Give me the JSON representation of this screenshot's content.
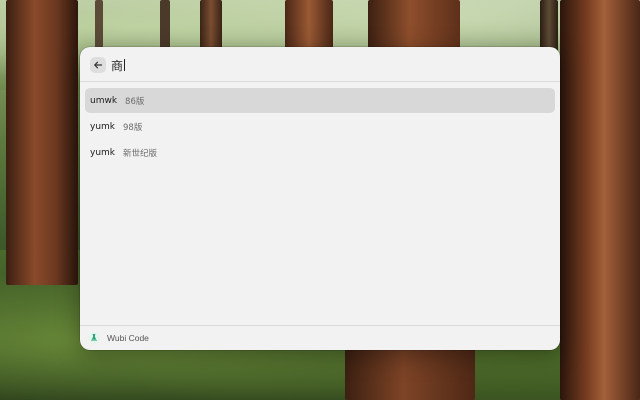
{
  "search": {
    "query": "商",
    "back_label": "Back"
  },
  "results": [
    {
      "code": "umwk",
      "version": "86版",
      "selected": true
    },
    {
      "code": "yumk",
      "version": "98版",
      "selected": false
    },
    {
      "code": "yumk",
      "version": "新世纪版",
      "selected": false
    }
  ],
  "footer": {
    "extension_name": "Wubi Code",
    "icon": "wubi-code-app-icon"
  },
  "colors": {
    "window_bg": "#f2f2f2",
    "selected_row": "#d8d8d8",
    "icon_accent": "#2fa37a"
  }
}
